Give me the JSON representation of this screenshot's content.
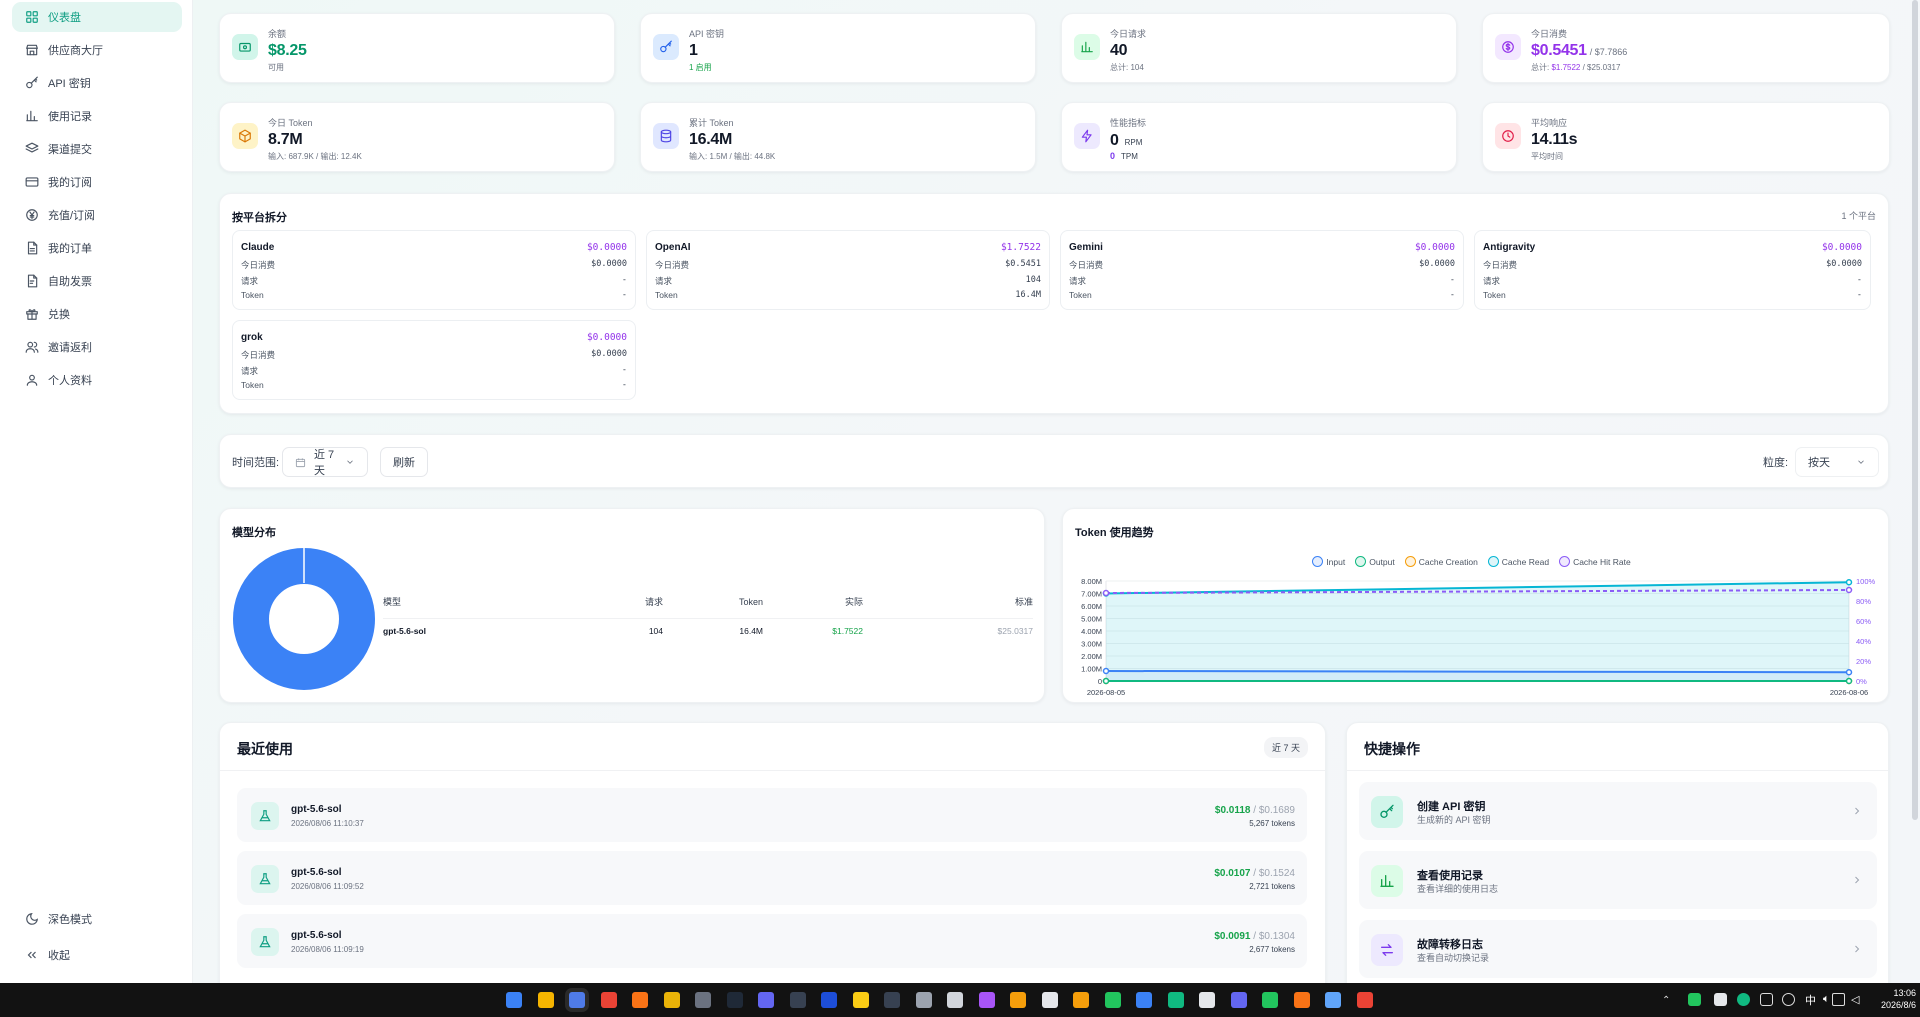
{
  "sidebar": {
    "items": [
      {
        "label": "仪表盘",
        "icon": "grid-icon",
        "active": true
      },
      {
        "label": "供应商大厅",
        "icon": "store-icon"
      },
      {
        "label": "API 密钥",
        "icon": "key-icon"
      },
      {
        "label": "使用记录",
        "icon": "bar-chart-icon"
      },
      {
        "label": "渠道提交",
        "icon": "layers-icon"
      },
      {
        "label": "我的订阅",
        "icon": "credit-card-icon"
      },
      {
        "label": "充值/订阅",
        "icon": "yuan-icon"
      },
      {
        "label": "我的订单",
        "icon": "document-icon"
      },
      {
        "label": "自助发票",
        "icon": "invoice-icon"
      },
      {
        "label": "兑换",
        "icon": "gift-icon"
      },
      {
        "label": "邀请返利",
        "icon": "users-icon"
      },
      {
        "label": "个人资料",
        "icon": "user-icon"
      }
    ],
    "dark_mode": "深色模式",
    "collapse": "收起"
  },
  "stats": [
    {
      "label": "余额",
      "value": "$8.25",
      "sub": "可用",
      "icon": "wallet-icon"
    },
    {
      "label": "API 密钥",
      "value": "1",
      "sub": "1 启用",
      "icon": "key-icon"
    },
    {
      "label": "今日请求",
      "value": "40",
      "sub": "总计: 104",
      "icon": "bar-chart-icon"
    },
    {
      "label": "今日消费",
      "value": "$0.5451",
      "value2": "/ $7.7866",
      "sub_prefix": "总计: ",
      "sub_a": "$1.7522",
      "sub_b": " / $25.0317",
      "icon": "dollar-icon"
    },
    {
      "label": "今日 Token",
      "value": "8.7M",
      "sub": "输入: 687.9K / 输出: 12.4K",
      "icon": "cube-icon"
    },
    {
      "label": "累计 Token",
      "value": "16.4M",
      "sub": "输入: 1.5M / 输出: 44.8K",
      "icon": "database-icon"
    },
    {
      "label": "性能指标",
      "rpm": "0",
      "rpm_unit": "RPM",
      "tpm": "0",
      "tpm_unit": "TPM",
      "icon": "lightning-icon"
    },
    {
      "label": "平均响应",
      "value": "14.11s",
      "sub": "平均时间",
      "icon": "clock-icon"
    }
  ],
  "platforms": {
    "title": "按平台拆分",
    "count": "1 个平台",
    "row_labels": [
      "今日消费",
      "请求",
      "Token"
    ],
    "items": [
      {
        "name": "Claude",
        "cost": "$0.0000",
        "today": "$0.0000",
        "requests": "-",
        "tokens": "-"
      },
      {
        "name": "OpenAI",
        "cost": "$1.7522",
        "today": "$0.5451",
        "requests": "104",
        "tokens": "16.4M"
      },
      {
        "name": "Gemini",
        "cost": "$0.0000",
        "today": "$0.0000",
        "requests": "-",
        "tokens": "-"
      },
      {
        "name": "Antigravity",
        "cost": "$0.0000",
        "today": "$0.0000",
        "requests": "-",
        "tokens": "-"
      },
      {
        "name": "grok",
        "cost": "$0.0000",
        "today": "$0.0000",
        "requests": "-",
        "tokens": "-"
      }
    ]
  },
  "filters": {
    "time_range_label": "时间范围:",
    "time_range_value": "近 7 天",
    "refresh": "刷新",
    "granularity_label": "粒度:",
    "granularity_value": "按天"
  },
  "model_dist": {
    "title": "模型分布",
    "headers": [
      "模型",
      "请求",
      "Token",
      "实际",
      "标准"
    ],
    "rows": [
      [
        "gpt-5.6-sol",
        "104",
        "16.4M",
        "$1.7522",
        "$25.0317"
      ]
    ],
    "color": "#3b82f6"
  },
  "chart_data": {
    "type": "line",
    "title": "Token 使用趋势",
    "x": [
      "2026-08-05",
      "2026-08-06"
    ],
    "yticks": [
      "8.00M",
      "7.00M",
      "6.00M",
      "5.00M",
      "4.00M",
      "3.00M",
      "2.00M",
      "1.00M",
      "0"
    ],
    "y2ticks": [
      "100%",
      "80%",
      "60%",
      "40%",
      "20%",
      "0%"
    ],
    "ylim": [
      0,
      8000000
    ],
    "y2lim": [
      0,
      100
    ],
    "series": [
      {
        "name": "Input",
        "color": "#3b82f6",
        "values": [
          800000,
          700000
        ],
        "axis": "left"
      },
      {
        "name": "Output",
        "color": "#10b981",
        "values": [
          0,
          0
        ],
        "axis": "left"
      },
      {
        "name": "Cache Creation",
        "color": "#f59e0b",
        "values": [
          0,
          0
        ],
        "axis": "left"
      },
      {
        "name": "Cache Read",
        "color": "#06b6d4",
        "values": [
          7000000,
          7900000
        ],
        "axis": "left"
      },
      {
        "name": "Cache Hit Rate",
        "color": "#8b5cf6",
        "values": [
          88,
          91
        ],
        "axis": "right"
      }
    ]
  },
  "recent": {
    "title": "最近使用",
    "badge": "近 7 天",
    "items": [
      {
        "model": "gpt-5.6-sol",
        "time": "2026/08/06 11:10:37",
        "actual": "$0.0118",
        "standard": "/ $0.1689",
        "tokens": "5,267 tokens"
      },
      {
        "model": "gpt-5.6-sol",
        "time": "2026/08/06 11:09:52",
        "actual": "$0.0107",
        "standard": "/ $0.1524",
        "tokens": "2,721 tokens"
      },
      {
        "model": "gpt-5.6-sol",
        "time": "2026/08/06 11:09:19",
        "actual": "$0.0091",
        "standard": "/ $0.1304",
        "tokens": "2,677 tokens"
      }
    ]
  },
  "quick": {
    "title": "快捷操作",
    "items": [
      {
        "title": "创建 API 密钥",
        "desc": "生成新的 API 密钥",
        "icon": "key-icon"
      },
      {
        "title": "查看使用记录",
        "desc": "查看详细的使用日志",
        "icon": "bar-chart-icon"
      },
      {
        "title": "故障转移日志",
        "desc": "查看自动切换记录",
        "icon": "swap-icon"
      }
    ]
  },
  "taskbar": {
    "time": "13:06",
    "date": "2026/8/6",
    "ime": "中"
  }
}
